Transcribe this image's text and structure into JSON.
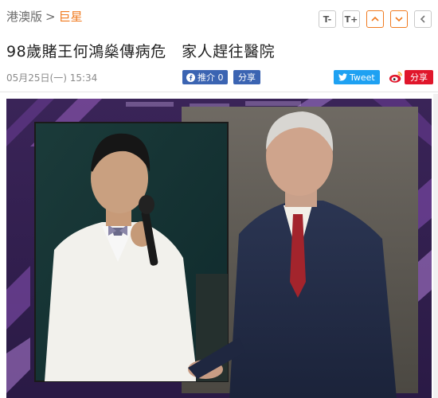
{
  "breadcrumb": {
    "section": "港澳版",
    "separator": ">",
    "current": "巨星"
  },
  "tools": {
    "font_down": "T-",
    "font_up": "T+"
  },
  "article": {
    "title": "98歲賭王何鴻燊傳病危　家人趕往醫院",
    "timestamp": "05月25日(一) 15:34"
  },
  "share": {
    "facebook_like": "推介 0",
    "facebook_share": "分享",
    "twitter": "Tweet",
    "weibo": "分享"
  },
  "colors": {
    "accent": "#f07a1f",
    "facebook": "#3b64b2",
    "twitter": "#1ea1f2",
    "weibo": "#e0162b"
  },
  "icons": {
    "font_down": "text-smaller-icon",
    "font_up": "text-larger-icon",
    "prev": "chevron-up-icon",
    "next": "chevron-down-icon",
    "back": "chevron-left-icon"
  }
}
